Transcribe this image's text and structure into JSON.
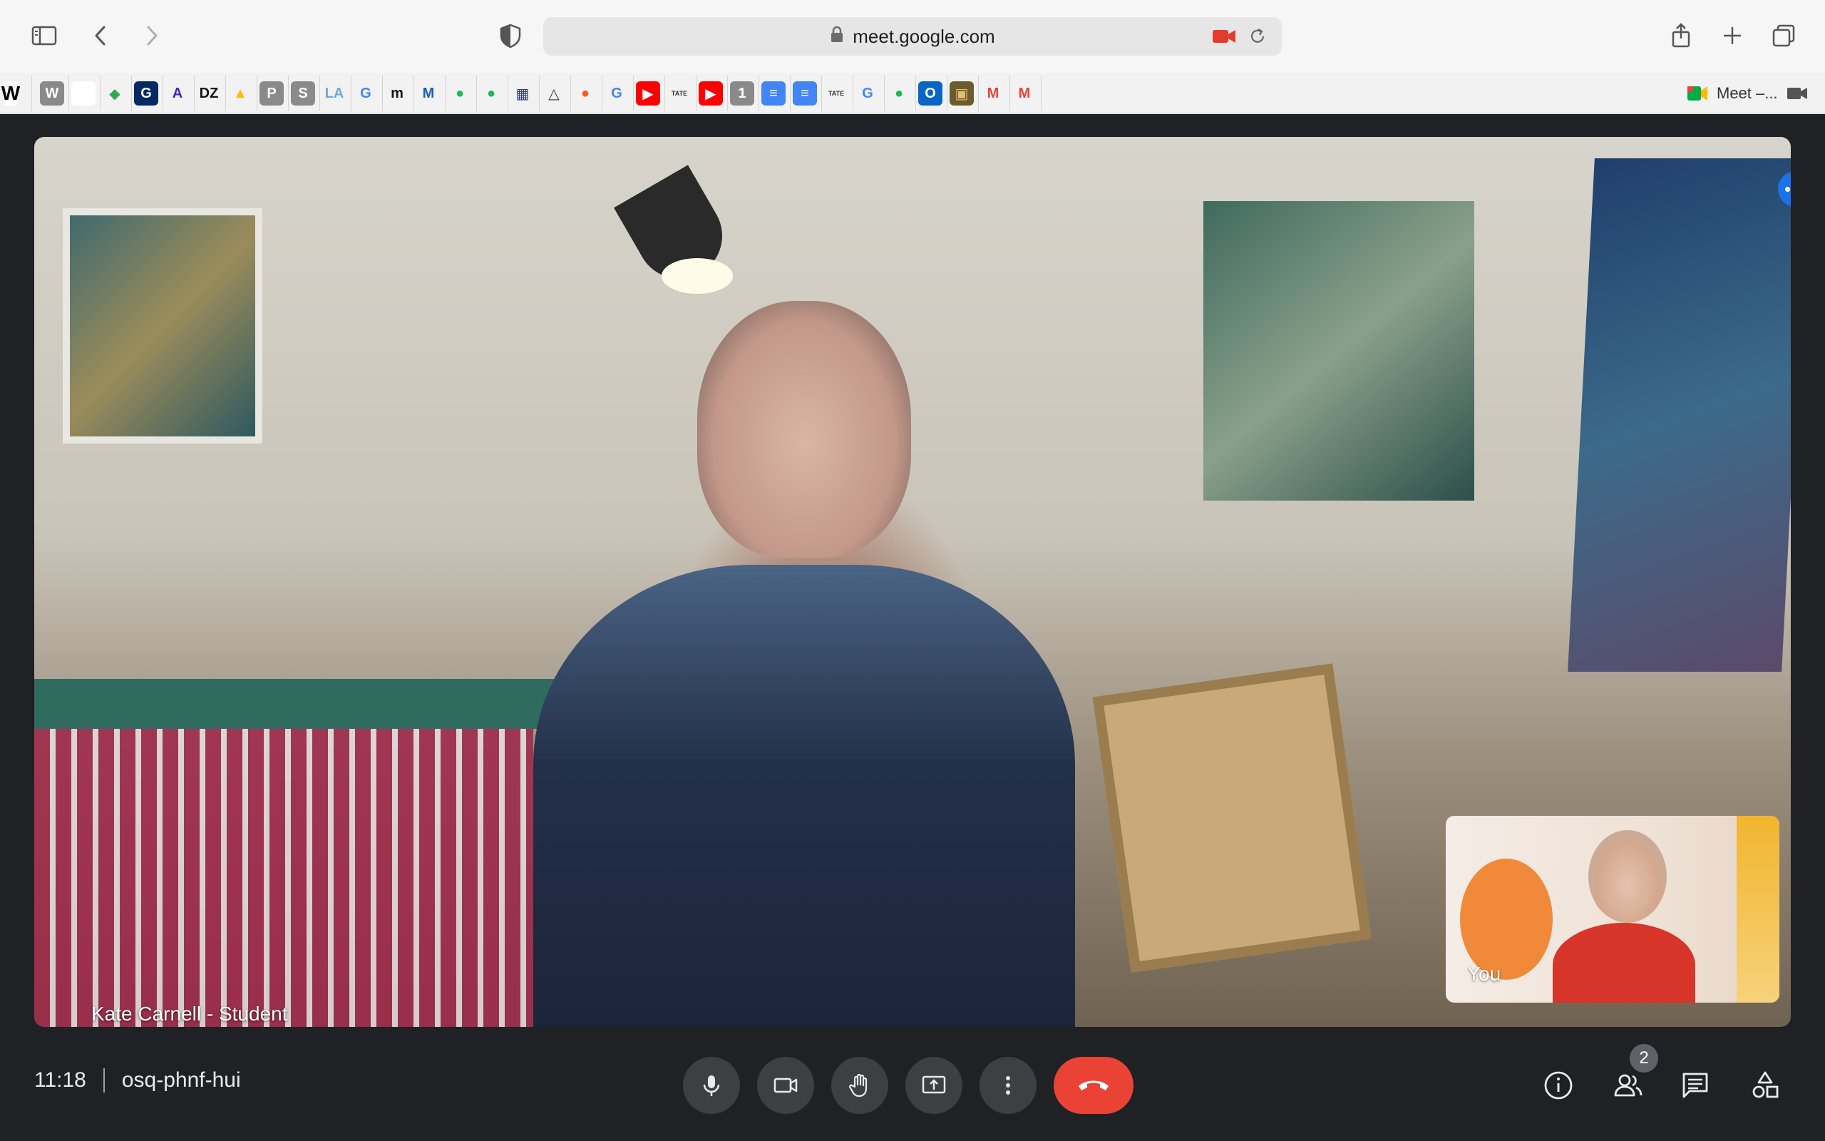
{
  "browser": {
    "url": "meet.google.com",
    "bookmark_meet_label": "Meet –...",
    "bookmarks": [
      {
        "name": "wikipedia",
        "glyph": "W",
        "bg": "#ffffff",
        "fg": "#000000"
      },
      {
        "name": "w-app",
        "glyph": "W",
        "bg": "#8a8a8a",
        "fg": "#ffffff"
      },
      {
        "name": "blank-page",
        "glyph": "",
        "bg": "#ffffff",
        "fg": "#000000"
      },
      {
        "name": "maps",
        "glyph": "◆",
        "bg": "#f2f2f2",
        "fg": "#34a853"
      },
      {
        "name": "guardian",
        "glyph": "G",
        "bg": "#052962",
        "fg": "#ffffff"
      },
      {
        "name": "atlantic",
        "glyph": "A",
        "bg": "#f2f2f2",
        "fg": "#3a2bb8"
      },
      {
        "name": "dz",
        "glyph": "DZ",
        "bg": "#f2f2f2",
        "fg": "#111111"
      },
      {
        "name": "drive",
        "glyph": "▲",
        "bg": "#f2f2f2",
        "fg": "#fbbc04"
      },
      {
        "name": "p-app",
        "glyph": "P",
        "bg": "#8a8a8a",
        "fg": "#ffffff"
      },
      {
        "name": "s-app",
        "glyph": "S",
        "bg": "#8a8a8a",
        "fg": "#ffffff"
      },
      {
        "name": "la",
        "glyph": "LA",
        "bg": "#f2f2f2",
        "fg": "#6fa8dc"
      },
      {
        "name": "google-1",
        "glyph": "G",
        "bg": "#f2f2f2",
        "fg": "#4285f4"
      },
      {
        "name": "m-serif",
        "glyph": "m",
        "bg": "#f2f2f2",
        "fg": "#111111"
      },
      {
        "name": "m-blue",
        "glyph": "M",
        "bg": "#f2f2f2",
        "fg": "#1a5fb4"
      },
      {
        "name": "spotify-1",
        "glyph": "●",
        "bg": "#f2f2f2",
        "fg": "#1db954"
      },
      {
        "name": "spotify-2",
        "glyph": "●",
        "bg": "#f2f2f2",
        "fg": "#1db954"
      },
      {
        "name": "grid-app",
        "glyph": "▦",
        "bg": "#f2f2f2",
        "fg": "#2b3a8c"
      },
      {
        "name": "triangle-app",
        "glyph": "△",
        "bg": "#f2f2f2",
        "fg": "#333333"
      },
      {
        "name": "orange-app",
        "glyph": "●",
        "bg": "#f2f2f2",
        "fg": "#ff5722"
      },
      {
        "name": "google-2",
        "glyph": "G",
        "bg": "#f2f2f2",
        "fg": "#4285f4"
      },
      {
        "name": "youtube-1",
        "glyph": "▶",
        "bg": "#ff0000",
        "fg": "#ffffff"
      },
      {
        "name": "tate-1",
        "glyph": "TATE",
        "bg": "#f2f2f2",
        "fg": "#333333"
      },
      {
        "name": "youtube-2",
        "glyph": "▶",
        "bg": "#ff0000",
        "fg": "#ffffff"
      },
      {
        "name": "one-app",
        "glyph": "1",
        "bg": "#8a8a8a",
        "fg": "#ffffff"
      },
      {
        "name": "docs-1",
        "glyph": "≡",
        "bg": "#4285f4",
        "fg": "#ffffff"
      },
      {
        "name": "docs-2",
        "glyph": "≡",
        "bg": "#4285f4",
        "fg": "#ffffff"
      },
      {
        "name": "tate-2",
        "glyph": "TATE",
        "bg": "#f2f2f2",
        "fg": "#333333"
      },
      {
        "name": "google-3",
        "glyph": "G",
        "bg": "#f2f2f2",
        "fg": "#4285f4"
      },
      {
        "name": "spotify-3",
        "glyph": "●",
        "bg": "#f2f2f2",
        "fg": "#1db954"
      },
      {
        "name": "outlook",
        "glyph": "O",
        "bg": "#0a64c4",
        "fg": "#ffffff"
      },
      {
        "name": "photo-app",
        "glyph": "▣",
        "bg": "#6b5b2e",
        "fg": "#e0c070"
      },
      {
        "name": "gmail-1",
        "glyph": "M",
        "bg": "#f2f2f2",
        "fg": "#ea4335"
      },
      {
        "name": "gmail-2",
        "glyph": "M",
        "bg": "#f2f2f2",
        "fg": "#ea4335"
      }
    ]
  },
  "meet": {
    "main_participant_name": "Kate Carnell - Student",
    "self_label": "You",
    "time": "11:18",
    "meeting_code": "osq-phnf-hui",
    "participant_count": "2"
  },
  "colors": {
    "stage_bg": "#202124",
    "control_bg": "#3c4043",
    "hangup": "#ea4335",
    "accent": "#1a73e8"
  }
}
